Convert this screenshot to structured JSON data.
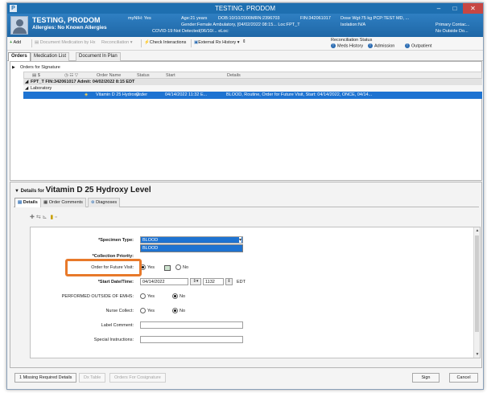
{
  "window": {
    "title": "TESTING, PRODOM",
    "app_icon_glyph": "P"
  },
  "banner": {
    "patient_name": "TESTING, PRODOM",
    "allergies": "Allergies: No Known Allergies",
    "mynih": "myNIH: Yes",
    "age": "Age:21 years",
    "dob_mrn": "DOB:10/10/2000MRN:2396703",
    "gender_loc": "Gender:Female  Ambulatory, [04/02/2022 08:15... Loc:FPT_T",
    "covid": "COVID-19:Not Detected(06/10/... eLoc:",
    "fin": "FIN:342061017",
    "isolation": "Isolation:N/A",
    "dose_wgt": "Dose Wgt:75 kg PCP:TEST MD, ...",
    "primary_contact": "Primary Contac...",
    "outside_do": "No Outside Do..."
  },
  "toolbar": {
    "add": "Add",
    "document_medication": "Document Medication by Hx",
    "reconciliation": "Reconciliation",
    "check_interactions": "Check Interactions",
    "external_rx": "External Rx History",
    "recon_status": "Reconciliation Status",
    "meds_history": "Meds History",
    "admission": "Admission",
    "outpatient": "Outpatient"
  },
  "tabs": [
    "Orders",
    "Medication List",
    "Document In Plan"
  ],
  "orders": {
    "group": "Orders for Signature",
    "columns": {
      "order_name": "Order Name",
      "status": "Status",
      "start": "Start",
      "details": "Details"
    },
    "encounter_row": "FPT_T  FIN:342061017  Admit: 04/02/2022 8:15 EDT",
    "category_row": "Laboratory",
    "order": {
      "name": "Vitamin D 25 Hydroxy...",
      "status": "Order",
      "start": "04/14/2022 11:32 E...",
      "details": "BLOOD, Routine, Order for Future Visit, Start: 04/14/2022, ONCE, 04/14..."
    }
  },
  "details": {
    "prefix": "Details for",
    "title": "Vitamin D 25 Hydroxy Level",
    "tabs": [
      "Details",
      "Order Comments",
      "Diagnoses"
    ],
    "fields": {
      "specimen_type_label": "*Specimen Type:",
      "specimen_type_value": "BLOOD",
      "dropdown_option": "BLOOD",
      "collection_priority_label": "*Collection Priority:",
      "future_visit_label": "Order for Future Visit:",
      "yes": "Yes",
      "no": "No",
      "start_label": "*Start Date/Time:",
      "start_date": "04/14/2022",
      "start_time": "1132",
      "timezone": "EDT",
      "performed_outside_label": "PERFORMED OUTSIDE OF EMHS:",
      "nurse_collect_label": "Nurse Collect:",
      "label_comment_label": "Label Comment:",
      "special_instructions_label": "Special Instructions:"
    }
  },
  "footer": {
    "missing": "1 Missing Required Details",
    "dx_table": "Dx Table",
    "orders_cosignature": "Orders For Cosignature",
    "sign": "Sign",
    "cancel": "Cancel"
  },
  "colors": {
    "accent": "#1e6fb0",
    "selection": "#1e73d1",
    "highlight": "#e8792a"
  }
}
